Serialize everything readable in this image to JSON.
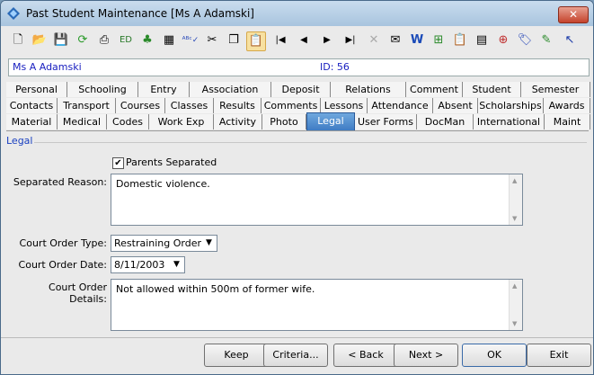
{
  "window": {
    "title": "Past Student Maintenance  [Ms A Adamski]",
    "close_symbol": "✕"
  },
  "toolbar": {
    "icons": [
      "new-icon",
      "open-icon",
      "save-icon",
      "refresh-icon",
      "print-icon",
      "edit-icon",
      "tree-icon",
      "calculator-icon",
      "spellcheck-icon",
      "cut-icon",
      "copy-icon",
      "paste-icon",
      "first-record-icon",
      "prev-record-icon",
      "next-record-icon",
      "last-record-icon",
      "delete-icon",
      "email-icon",
      "word-icon",
      "excel-icon",
      "clipboard-icon",
      "id-card-icon",
      "add-record-icon",
      "tag-icon",
      "notepad-icon",
      "pointer-icon"
    ]
  },
  "student": {
    "name": "Ms A Adamski",
    "id_label": "ID: 56"
  },
  "tabs": {
    "row1": [
      "Personal",
      "Schooling",
      "Entry",
      "Association",
      "Deposit",
      "Relations",
      "Comment",
      "Student",
      "Semester"
    ],
    "row2": [
      "Contacts",
      "Transport",
      "Courses",
      "Classes",
      "Results",
      "Comments",
      "Lessons",
      "Attendance",
      "Absent",
      "Scholarships",
      "Awards"
    ],
    "row3": [
      "Material",
      "Medical",
      "Codes",
      "Work Exp",
      "Activity",
      "Photo",
      "Legal",
      "User Forms",
      "DocMan",
      "International",
      "Maint"
    ]
  },
  "legal": {
    "group_label": "Legal",
    "parents_separated_label": "Parents Separated",
    "parents_separated_checked": "✔",
    "separated_reason_label": "Separated Reason:",
    "separated_reason_value": "Domestic violence.",
    "court_order_type_label": "Court Order Type:",
    "court_order_type_value": "Restraining Order",
    "court_order_date_label": "Court Order Date:",
    "court_order_date_value": "8/11/2003",
    "court_order_details_label": "Court Order Details:",
    "court_order_details_value": "Not allowed within 500m of former wife."
  },
  "buttons": {
    "keep": "Keep",
    "criteria": "Criteria...",
    "back": "< Back",
    "next": "Next >",
    "ok": "OK",
    "exit": "Exit"
  }
}
